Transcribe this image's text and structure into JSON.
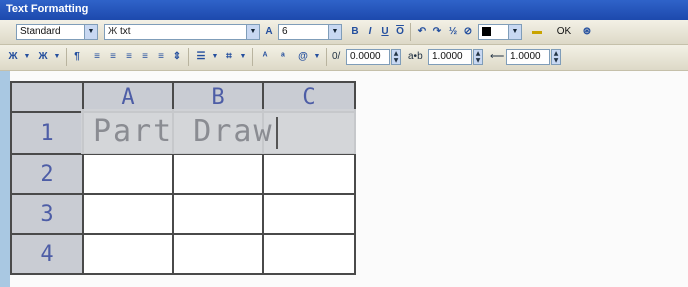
{
  "window": {
    "title": "Text Formatting"
  },
  "toolbar1": {
    "style_value": "Standard",
    "font_value": "txt",
    "height_value": "6",
    "bold": "B",
    "italic": "I",
    "underline": "U",
    "overline": "O",
    "ok_label": "OK"
  },
  "toolbar2": {
    "oblique_value": "0.0000",
    "tracking_value": "1.0000",
    "width_value": "1.0000"
  },
  "sheet": {
    "col_headers": [
      "A",
      "B",
      "C"
    ],
    "row_headers": [
      "1",
      "2",
      "3",
      "4"
    ]
  },
  "editor": {
    "text": "Part Draw"
  },
  "colors": {
    "titlebar": "#1d49ad",
    "toolbar": "#ece9d8",
    "sheet_ink": "#4d5da6",
    "header_fill": "#c9ccd3"
  }
}
